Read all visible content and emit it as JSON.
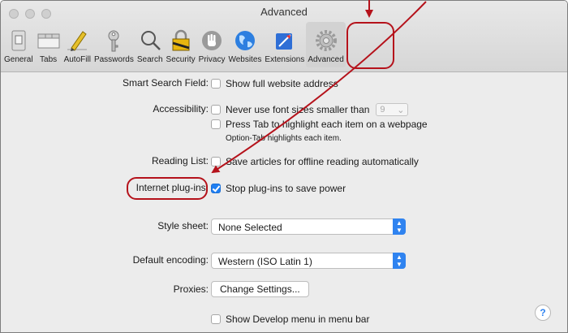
{
  "window": {
    "title": "Advanced",
    "traffic_lights": [
      "close-button",
      "minimize-button",
      "zoom-button"
    ]
  },
  "toolbar": {
    "items": [
      {
        "label": "General",
        "icon": "general-switch-icon"
      },
      {
        "label": "Tabs",
        "icon": "tabs-icon"
      },
      {
        "label": "AutoFill",
        "icon": "pencil-icon"
      },
      {
        "label": "Passwords",
        "icon": "key-icon"
      },
      {
        "label": "Search",
        "icon": "magnifier-icon"
      },
      {
        "label": "Security",
        "icon": "lock-icon"
      },
      {
        "label": "Privacy",
        "icon": "hand-icon"
      },
      {
        "label": "Websites",
        "icon": "globe-icon"
      },
      {
        "label": "Extensions",
        "icon": "puzzle-icon"
      },
      {
        "label": "Advanced",
        "icon": "gear-icon",
        "selected": true
      }
    ]
  },
  "prefs": {
    "smart_search": {
      "label": "Smart Search Field:",
      "option": "Show full website address",
      "checked": false
    },
    "accessibility": {
      "label": "Accessibility:",
      "font_option": "Never use font sizes smaller than",
      "font_size": "9",
      "font_checked": false,
      "tab_option": "Press Tab to highlight each item on a webpage",
      "tab_checked": false,
      "tab_hint": "Option-Tab highlights each item."
    },
    "reading_list": {
      "label": "Reading List:",
      "option": "Save articles for offline reading automatically",
      "checked": false
    },
    "plugins": {
      "label": "Internet plug-ins:",
      "option": "Stop plug-ins to save power",
      "checked": true
    },
    "style_sheet": {
      "label": "Style sheet:",
      "value": "None Selected"
    },
    "encoding": {
      "label": "Default encoding:",
      "value": "Western (ISO Latin 1)"
    },
    "proxies": {
      "label": "Proxies:",
      "button": "Change Settings..."
    },
    "develop": {
      "option": "Show Develop menu in menu bar",
      "checked": false
    }
  },
  "help": {
    "label": "?"
  },
  "colors": {
    "accent": "#1f7ff2",
    "annotation": "#b5121b"
  }
}
